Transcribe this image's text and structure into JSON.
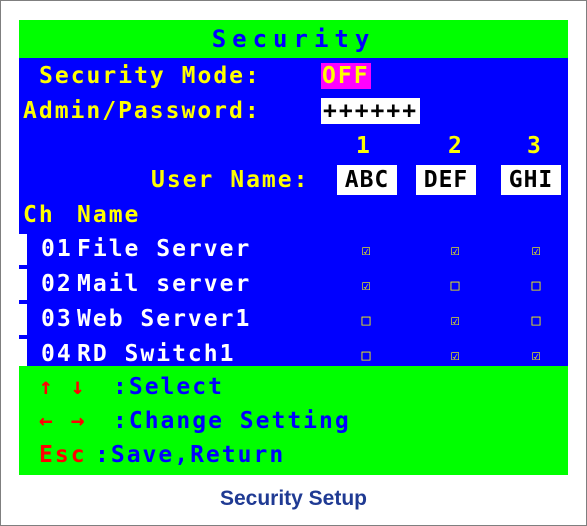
{
  "osd": {
    "title": "Security",
    "security_mode_label": "Security Mode:",
    "security_mode_value": "OFF",
    "admin_password_label": "Admin/Password:",
    "admin_password_value": "++++++",
    "user_columns": [
      "1",
      "2",
      "3"
    ],
    "user_name_label": "User Name:",
    "user_names": [
      "ABC",
      "DEF",
      "GHI"
    ],
    "header_ch": "Ch",
    "header_name": "Name",
    "channels": [
      {
        "ch": "01",
        "name": "File Server",
        "access": [
          true,
          true,
          true
        ]
      },
      {
        "ch": "02",
        "name": "Mail server",
        "access": [
          true,
          false,
          false
        ]
      },
      {
        "ch": "03",
        "name": "Web Server1",
        "access": [
          false,
          true,
          false
        ]
      },
      {
        "ch": "04",
        "name": "RD Switch1",
        "access": [
          false,
          true,
          true
        ]
      }
    ],
    "checked_glyph": "☑",
    "unchecked_glyph": "□",
    "footer": {
      "select_keys": "↑ ↓",
      "select_label": ":Select",
      "change_keys": "← →",
      "change_label": ":Change Setting",
      "esc_key": "Esc",
      "esc_label": ":Save,Return"
    },
    "colors": {
      "background": "#0000ff",
      "band": "#00ff00",
      "label": "#ffff00",
      "highlight": "#ff00ff"
    }
  },
  "caption": "Security Setup"
}
